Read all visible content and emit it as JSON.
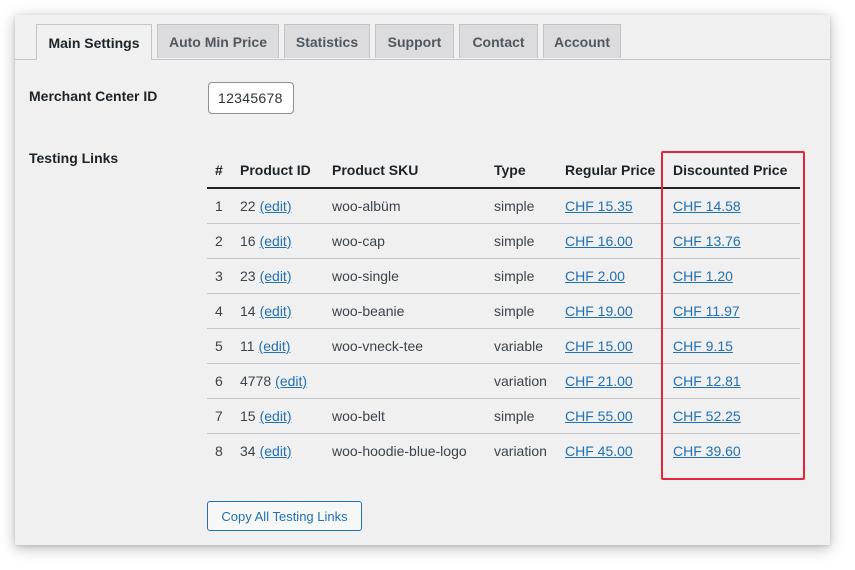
{
  "tabs": [
    {
      "label": "Main Settings",
      "active": true
    },
    {
      "label": "Auto Min Price",
      "active": false
    },
    {
      "label": "Statistics",
      "active": false
    },
    {
      "label": "Support",
      "active": false
    },
    {
      "label": "Contact",
      "active": false
    },
    {
      "label": "Account",
      "active": false
    }
  ],
  "merchant": {
    "label": "Merchant Center ID",
    "value": "12345678"
  },
  "testing": {
    "label": "Testing Links",
    "columns": [
      "#",
      "Product ID",
      "Product SKU",
      "Type",
      "Regular Price",
      "Discounted Price"
    ],
    "edit_label": "(edit)",
    "rows": [
      {
        "num": "1",
        "id": "22",
        "sku": "woo-albüm",
        "type": "simple",
        "regular": "CHF 15.35",
        "discounted": "CHF 14.58"
      },
      {
        "num": "2",
        "id": "16",
        "sku": "woo-cap",
        "type": "simple",
        "regular": "CHF 16.00",
        "discounted": "CHF 13.76"
      },
      {
        "num": "3",
        "id": "23",
        "sku": "woo-single",
        "type": "simple",
        "regular": "CHF 2.00",
        "discounted": "CHF 1.20"
      },
      {
        "num": "4",
        "id": "14",
        "sku": "woo-beanie",
        "type": "simple",
        "regular": "CHF 19.00",
        "discounted": "CHF 11.97"
      },
      {
        "num": "5",
        "id": "11",
        "sku": "woo-vneck-tee",
        "type": "variable",
        "regular": "CHF 15.00",
        "discounted": "CHF 9.15"
      },
      {
        "num": "6",
        "id": "4778",
        "sku": "",
        "type": "variation",
        "regular": "CHF 21.00",
        "discounted": "CHF 12.81"
      },
      {
        "num": "7",
        "id": "15",
        "sku": "woo-belt",
        "type": "simple",
        "regular": "CHF 55.00",
        "discounted": "CHF 52.25"
      },
      {
        "num": "8",
        "id": "34",
        "sku": "woo-hoodie-blue-logo",
        "type": "variation",
        "regular": "CHF 45.00",
        "discounted": "CHF 39.60"
      }
    ],
    "copy_button": "Copy All Testing Links"
  },
  "colors": {
    "link": "#2271b1",
    "highlight": "#e3263a",
    "panel": "#f0f0f1"
  }
}
